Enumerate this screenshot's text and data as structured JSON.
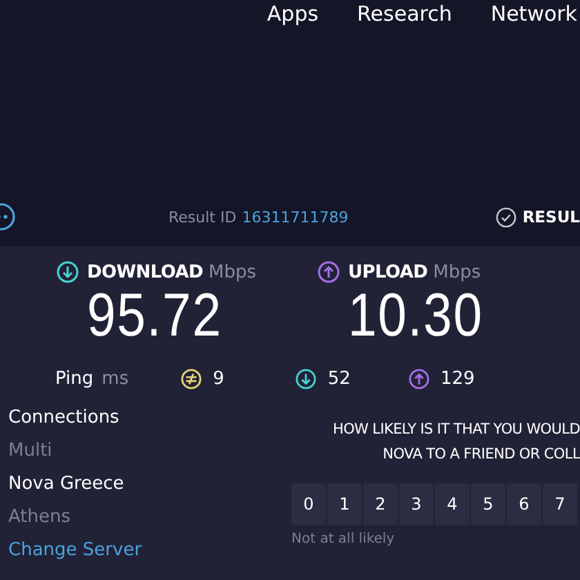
{
  "nav": [
    "Apps",
    "Research",
    "Network"
  ],
  "result": {
    "label": "Result ID",
    "id": "16311711789",
    "results_label": "RESUL"
  },
  "speeds": [
    {
      "kind": "download",
      "label": "DOWNLOAD",
      "unit": "Mbps",
      "value": "95.72"
    },
    {
      "kind": "upload",
      "label": "UPLOAD",
      "unit": "Mbps",
      "value": "10.30"
    }
  ],
  "ping": {
    "label": "Ping",
    "unit": "ms",
    "values": [
      {
        "kind": "idle",
        "value": "9"
      },
      {
        "kind": "download",
        "value": "52"
      },
      {
        "kind": "upload",
        "value": "129"
      }
    ]
  },
  "connections": {
    "label": "Connections",
    "value": "Multi"
  },
  "server": {
    "name": "Nova Greece",
    "location": "Athens",
    "change_link": "Change Server"
  },
  "survey": {
    "question_lines": [
      "HOW LIKELY IS IT THAT YOU WOULD",
      "NOVA TO A FRIEND OR COLL"
    ],
    "options": [
      "0",
      "1",
      "2",
      "3",
      "4",
      "5",
      "6",
      "7"
    ],
    "low_label": "Not at all likely"
  }
}
